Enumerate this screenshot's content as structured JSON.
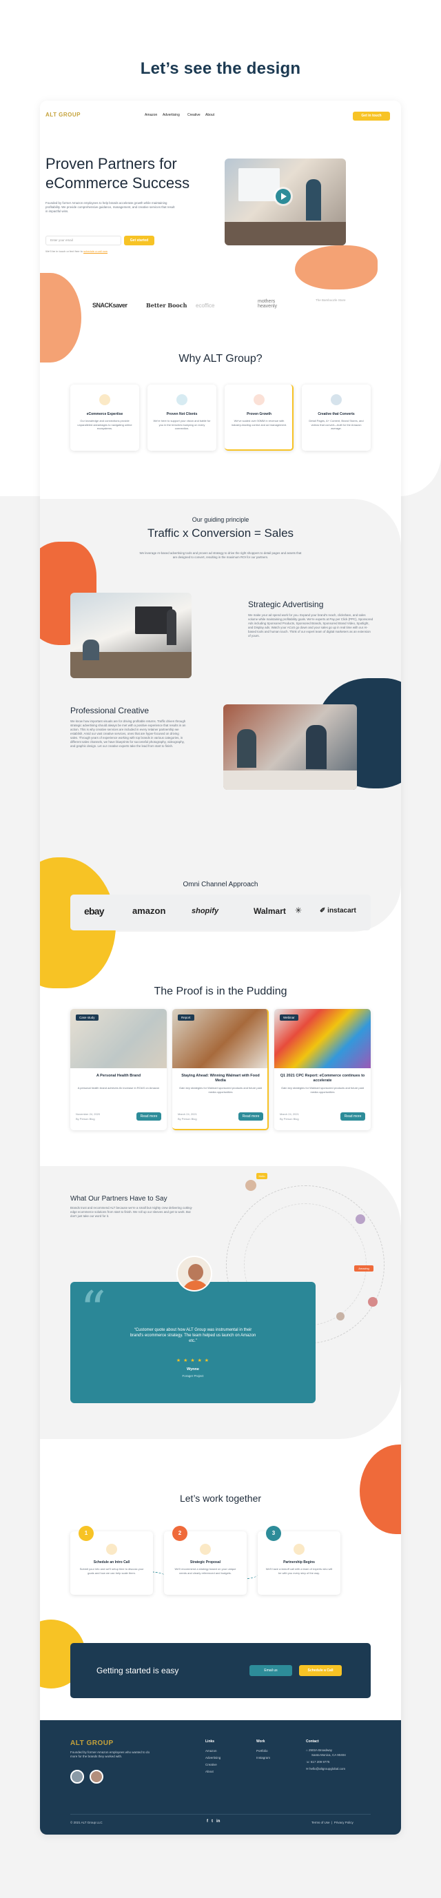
{
  "heading": "Let’s see the design",
  "nav": {
    "logo": "ALT GROUP",
    "links": [
      "Amazon",
      "Advertising",
      "Creative",
      "About"
    ],
    "cta": "Get in touch"
  },
  "hero": {
    "title_line1": "Proven Partners for",
    "title_line2": "eCommerce Success",
    "body": "Founded by former Amazon employees to help brands accelerate growth while maintaining profitability. We provide comprehensive guidance, management, and creative services that result in impactful wins.",
    "email_placeholder": "Enter your email",
    "submit": "Get started",
    "note": "We’ll be in touch or feel free to",
    "note_link": "schedule a call now"
  },
  "logos": [
    "SNACKsaver",
    "Better Booch",
    "ecoffice",
    "mothers heavenly",
    "The Bamboozle Store"
  ],
  "why": {
    "title": "Why ALT Group?",
    "items": [
      {
        "title": "eCommerce Expertise",
        "body": "Our knowledge and connections provide unparalleled advantages to navigating online ecosystems.",
        "color": "#fbe9c6",
        "icon": "lightbulb-icon"
      },
      {
        "title": "Proven Not Clients",
        "body": "We're here to support your vision and battle for you in the trenches bumping on every connection.",
        "color": "#d7ebf2",
        "icon": "handshake-icon"
      },
      {
        "title": "Proven Growth",
        "body": "We've scaled over 50MM in revenue with industry-leading control and ad management.",
        "color": "#fbe1d7",
        "icon": "trophy-icon"
      },
      {
        "title": "Creative that Converts",
        "body": "Detail Pages, A+ Content, Brand Stores, and videos that convert—built for the Amazon average.",
        "color": "#d6e3ec",
        "icon": "megaphone-icon"
      }
    ]
  },
  "principle": {
    "eyebrow": "Our guiding principle",
    "title": "Traffic x Conversion = Sales",
    "body": "We leverage AI-based advertising tools and proven ad strategy to drive the right shoppers to detail pages and assets that are designed to convert, resulting in the maximum ROI for our partners."
  },
  "advertising": {
    "title": "Strategic Advertising",
    "body": "We make your ad spend work for you. Expand your brand's reach, clickshare, and sales volume while maintaining profitability goals. We're experts at Pay per Click (PPC), Sponsored Ads including Sponsored Products, Sponsored Brands, Sponsored Brand Video, Spotlight, and Display ads. Watch your ACoS go down and your sales go up in real time with our AI-based tools and human touch. Think of our expert team of digital marketers as an extension of yours."
  },
  "creative": {
    "title": "Professional Creative",
    "body": "We know how important visuals are for driving profitable returns. Traffic driven through strategic advertising should always be met with a positive experience that results in an action. This is why creative services are included in every retainer partnership we establish. Amid our vast creative services, ones that are hyper-focused on driving sales. Through years of experience working with top brands in various categories, in different sales channels, we have blueprints for successful photography, videography, and graphic design. Let our creative experts take the lead from start to finish."
  },
  "omni": {
    "title": "Omni Channel Approach",
    "channels": [
      "ebay",
      "amazon",
      "shopify",
      "Walmart",
      "instacart"
    ]
  },
  "proof": {
    "title": "The Proof is in the Pudding",
    "posts": [
      {
        "tag": "Case study",
        "title": "A Personal Health Brand",
        "body": "A personal health brand achieves 8x increase in ROAS on Amazon",
        "date": "November 24, 2020",
        "author": "By Person Blog",
        "cta": "Read more"
      },
      {
        "tag": "Report",
        "title": "Staying Ahead: Winning Walmart with Food Media",
        "body": "Gain key strategies for Walmart sponsored products and future paid media opportunities",
        "date": "March 24, 2021",
        "author": "By Person Blog",
        "cta": "Read more"
      },
      {
        "tag": "Webinar",
        "title": "Q1 2021 CPC Report: eCommerce continues to accelerate",
        "body": "Gain key strategies for Walmart sponsored products and future paid media opportunities",
        "date": "March 24, 2021",
        "author": "By Person Blog",
        "cta": "Read more"
      }
    ]
  },
  "testimonials": {
    "title": "What Our Partners Have to Say",
    "body": "Brands trust and recommend ALT because we're a small but mighty crew delivering cutting-edge ecommerce solutions from start to finish. We roll up our sleeves and get to work. But don't just take our word for it.",
    "quote": "“Customer quote about how ALT Group was instrumental in their brand's ecommerce strategy. The team helped us launch on Amazon etc.”",
    "stars": "★ ★ ★ ★ ★",
    "name": "Wynne",
    "company": "Forager Project",
    "bubble1": "Hello",
    "bubble2": "Amazing"
  },
  "work": {
    "title": "Let’s work together",
    "steps": [
      {
        "n": "1",
        "title": "Schedule an Intro Call",
        "body": "Submit your info and we'll setup time to discuss your goals and how we can help scale them.",
        "color": "#f7c325"
      },
      {
        "n": "2",
        "title": "Strategic Proposal",
        "body": "We'll recommend a strategy based on your unique needs and clearly referenced and budgets.",
        "color": "#ef6a3a"
      },
      {
        "n": "3",
        "title": "Partnership Begins",
        "body": "We'll have a kickoff call with a team of experts who will be with you every step of the way.",
        "color": "#2d8c99"
      }
    ]
  },
  "cta": {
    "title": "Getting started is easy",
    "email": "Email us",
    "schedule": "Schedule a Call"
  },
  "footer": {
    "logo": "ALT GROUP",
    "about": "Founded by former Amazon employees who wanted to do more for the brands they worked with.",
    "col1": {
      "title": "Links",
      "items": [
        "Amazon",
        "Advertising",
        "Creative",
        "About"
      ]
    },
    "col2": {
      "title": "Work",
      "items": [
        "Portfolio",
        "Instagram"
      ]
    },
    "col3": {
      "title": "Contact",
      "address1": "2502A Broadway",
      "address2": "Santa Monica, CA 90404",
      "phone": "617 209 9775",
      "email": "hello@altgroupglobal.com"
    },
    "copyright": "© 2021 ALT Group LLC",
    "terms": "Terms of Use",
    "privacy": "Privacy Policy",
    "sep": "|"
  },
  "colors": {
    "navy": "#1c3a52",
    "teal": "#2d8c99",
    "yellow": "#f7c325",
    "orange": "#ef6a3a",
    "peach": "#f4a274"
  }
}
